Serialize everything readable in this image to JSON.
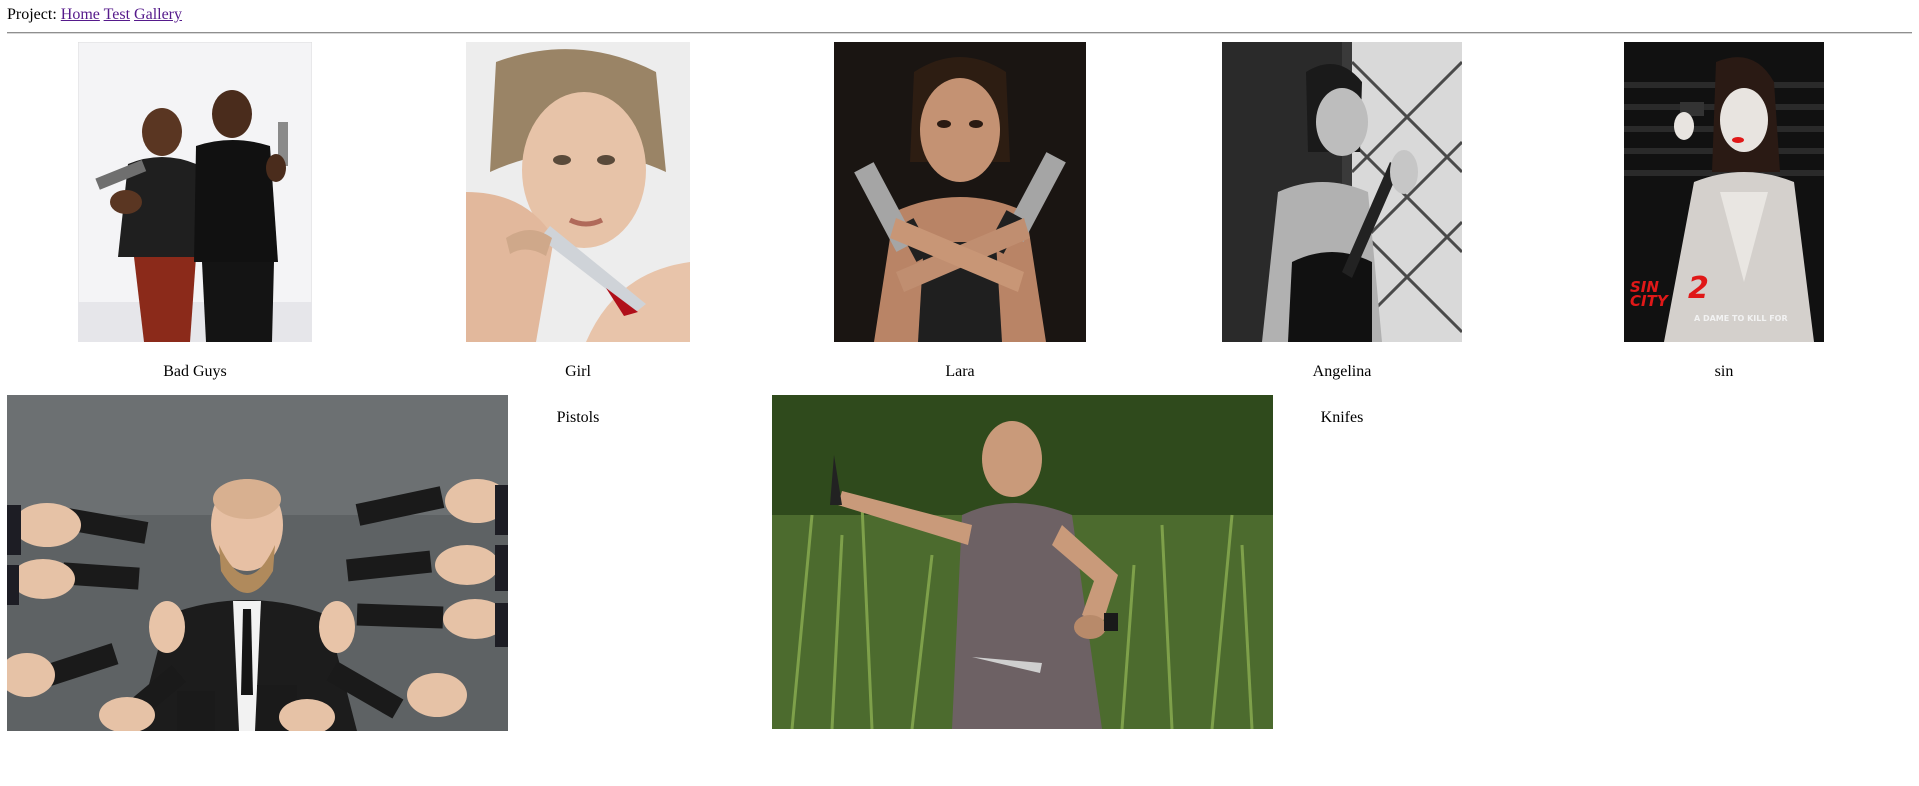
{
  "nav": {
    "prefix": "Project:",
    "links": [
      "Home",
      "Test",
      "Gallery"
    ]
  },
  "gallery": {
    "items": [
      {
        "caption": "Bad Guys",
        "alt": "Bad Guys"
      },
      {
        "caption": "Girl",
        "alt": "Girl"
      },
      {
        "caption": "Lara",
        "alt": "Lara"
      },
      {
        "caption": "Angelina",
        "alt": "Angelina"
      },
      {
        "caption": "sin",
        "alt": "sin"
      }
    ]
  },
  "wide": {
    "items": [
      {
        "caption": "Pistols",
        "alt": "Pistols"
      },
      {
        "caption": "Knifes",
        "alt": "Knifes"
      }
    ]
  },
  "poster": {
    "title_line1": "SIN",
    "title_line2": "CITY",
    "number": "2",
    "tagline": "A DAME TO KILL FOR"
  },
  "colors": {
    "link": "#551a8b",
    "rule": "#8f8f8f",
    "poster_red": "#e01818"
  }
}
